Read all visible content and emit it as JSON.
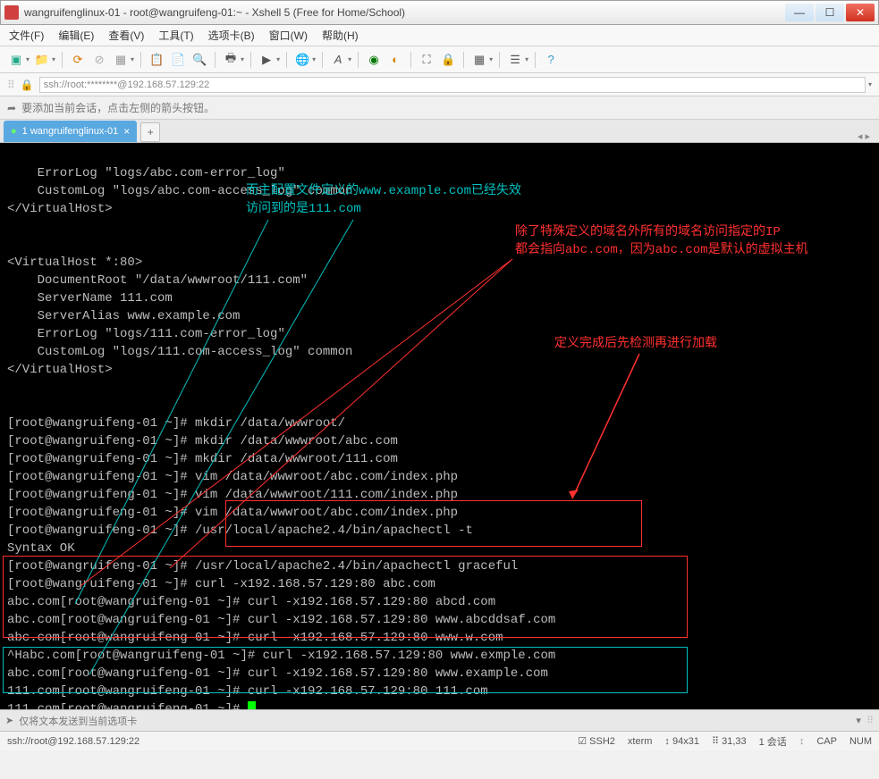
{
  "window": {
    "title": "wangruifenglinux-01 - root@wangruifeng-01:~ - Xshell 5 (Free for Home/School)"
  },
  "menubar": [
    "文件(F)",
    "编辑(E)",
    "查看(V)",
    "工具(T)",
    "选项卡(B)",
    "窗口(W)",
    "帮助(H)"
  ],
  "address": "ssh://root:********@192.168.57.129:22",
  "hint": "要添加当前会话，点击左侧的箭头按钮。",
  "tab": {
    "label": "1 wangruifenglinux-01"
  },
  "annotations": {
    "a1_line1": "而主配置文件定义的www.example.com已经失效",
    "a1_line2": "访问到的是111.com",
    "a2_line1": "除了特殊定义的域名外所有的域名访问指定的IP",
    "a2_line2": "都会指向abc.com，因为abc.com是默认的虚拟主机",
    "a3": "定义完成后先检测再进行加载"
  },
  "terminal": {
    "lines": [
      "    ErrorLog \"logs/abc.com-error_log\"",
      "    CustomLog \"logs/abc.com-access_log\" common",
      "</VirtualHost>",
      "",
      "",
      "<VirtualHost *:80>",
      "    DocumentRoot \"/data/wwwroot/111.com\"",
      "    ServerName 111.com",
      "    ServerAlias www.example.com",
      "    ErrorLog \"logs/111.com-error_log\"",
      "    CustomLog \"logs/111.com-access_log\" common",
      "</VirtualHost>",
      "",
      "",
      "[root@wangruifeng-01 ~]# mkdir /data/wwwroot/",
      "[root@wangruifeng-01 ~]# mkdir /data/wwwroot/abc.com",
      "[root@wangruifeng-01 ~]# mkdir /data/wwwroot/111.com",
      "[root@wangruifeng-01 ~]# vim /data/wwwroot/abc.com/index.php",
      "[root@wangruifeng-01 ~]# vim /data/wwwroot/111.com/index.php",
      "[root@wangruifeng-01 ~]# vim /data/wwwroot/abc.com/index.php",
      "[root@wangruifeng-01 ~]# /usr/local/apache2.4/bin/apachectl -t",
      "Syntax OK",
      "[root@wangruifeng-01 ~]# /usr/local/apache2.4/bin/apachectl graceful",
      "[root@wangruifeng-01 ~]# curl -x192.168.57.129:80 abc.com",
      "abc.com[root@wangruifeng-01 ~]# curl -x192.168.57.129:80 abcd.com",
      "abc.com[root@wangruifeng-01 ~]# curl -x192.168.57.129:80 www.abcddsaf.com",
      "abc.com[root@wangruifeng-01 ~]# curl -x192.168.57.129:80 www.w.com",
      "^Habc.com[root@wangruifeng-01 ~]# curl -x192.168.57.129:80 www.exmple.com",
      "abc.com[root@wangruifeng-01 ~]# curl -x192.168.57.129:80 www.example.com",
      "111.com[root@wangruifeng-01 ~]# curl -x192.168.57.129:80 111.com",
      "111.com[root@wangruifeng-01 ~]# "
    ]
  },
  "sendbar": "仅将文本发送到当前选项卡",
  "statusbar": {
    "conn": "ssh://root@192.168.57.129:22",
    "proto": "SSH2",
    "term": "xterm",
    "size": "94x31",
    "pos": "31,33",
    "sess": "1 会话",
    "cap": "CAP",
    "num": "NUM"
  }
}
